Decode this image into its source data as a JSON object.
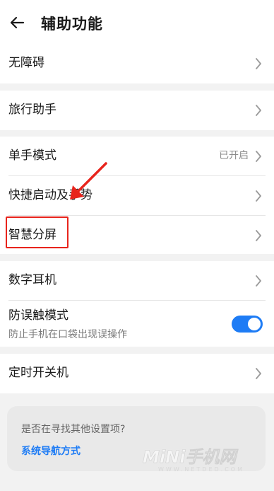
{
  "header": {
    "title": "辅助功能",
    "back_icon": "arrow-left-icon"
  },
  "rows": [
    {
      "label": "无障碍",
      "icon": "chevron-right-icon"
    },
    {
      "label": "旅行助手",
      "icon": "chevron-right-icon"
    },
    {
      "label": "单手模式",
      "value": "已开启",
      "icon": "chevron-right-icon"
    },
    {
      "label": "快捷启动及手势",
      "icon": "chevron-right-icon"
    },
    {
      "label": "智慧分屏",
      "icon": "chevron-right-icon"
    },
    {
      "label": "数字耳机",
      "icon": "chevron-right-icon"
    },
    {
      "label": "防误触模式",
      "sublabel": "防止手机在口袋出现误操作",
      "toggle_on": true
    },
    {
      "label": "定时开关机",
      "icon": "chevron-right-icon"
    }
  ],
  "suggestion": {
    "title": "是否在寻找其他设置项?",
    "link": "系统导航方式"
  },
  "colors": {
    "accent": "#1e7cf5",
    "annotation": "#e8241c",
    "background": "#f2f2f2"
  }
}
